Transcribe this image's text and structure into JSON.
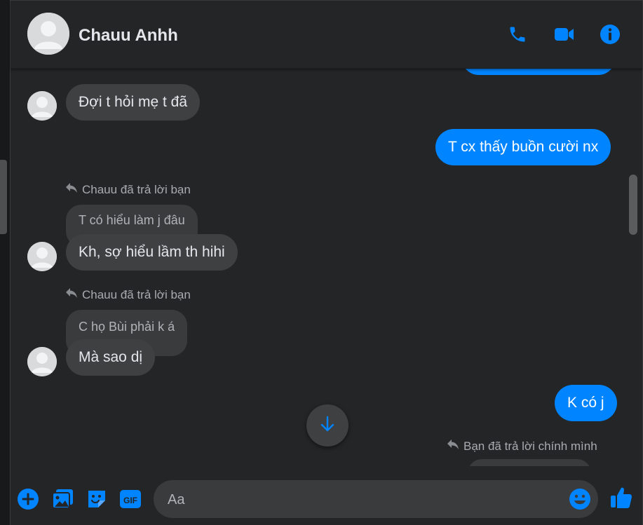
{
  "header": {
    "contact_name": "Chauu Anhh",
    "icons": [
      "phone-icon",
      "video-camera-icon",
      "info-icon"
    ]
  },
  "colors": {
    "accent": "#0084ff",
    "background": "#242526",
    "incoming_bubble": "#3e4042",
    "quote_bubble": "#3a3b3c"
  },
  "messages": {
    "m1": "Đợi t hỏi mẹ t đã",
    "m2": "T cx thấy buồn cười nx",
    "reply1_note": "Chauu đã trả lời bạn",
    "reply1_quote": "T có hiểu làm j đâu",
    "m3": "Kh, sợ hiểu lầm th hihi",
    "reply2_note": "Chauu đã trả lời bạn",
    "reply2_quote": "C họ Bùi phải k á",
    "m4": "Mà sao dị",
    "m5": "K có j",
    "reply3_note": "Bạn đã trả lời chính mình"
  },
  "composer": {
    "placeholder": "Aa",
    "icons": [
      "plus-icon",
      "photo-icon",
      "sticker-icon",
      "gif-icon",
      "emoji-icon",
      "like-icon"
    ]
  }
}
